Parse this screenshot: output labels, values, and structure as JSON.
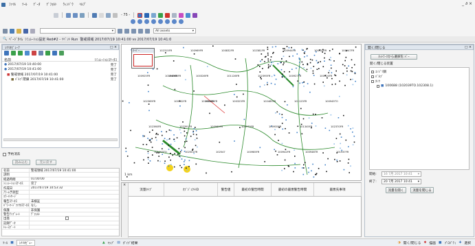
{
  "menus": [
    "ﾌｧｲﾙ",
    "ﾂｰﾙ",
    "ﾃﾞｰﾀ",
    "ﾃﾞﾌｫﾙﾄ",
    "ｳｨﾝﾄﾞｳ",
    "ﾍﾙﾌﾟ"
  ],
  "window_controls": "_ ∂ ×",
  "toolbar2": {
    "zoom_label": "- 75 -"
  },
  "toolbar3": {
    "layer_combo": "All assets"
  },
  "status": {
    "label": "ﾍﾟｰｼﾞﾀｲﾑ",
    "source": "ｼﾐｭﾚｰｼｮﾝ設定 Red#2 - ｲﾍﾞﾝﾄ Run",
    "compare": "警戒領域 2017/07/19 10:41:00 vs 2017/07/19 10:41:0"
  },
  "left_panel": {
    "title": "ｼﾅﾘｵﾋﾞｭｰｱ",
    "col_name": "名前",
    "col_status": "ｼﾐｭﾚｰｼｮﾝｽﾃｰﾀｽ",
    "tree": [
      {
        "label": "2017/07/19 10:40:00",
        "status": "完了"
      },
      {
        "label": "2017/07/19 10:41:00",
        "status": "完了"
      },
      {
        "label": "警戒領域 2017/07/19 10:41:00",
        "status": "完了"
      },
      {
        "label": "ﾊﾞﾙﾌﾞ閉鎖 2017/07/19 10:41:00",
        "status": "完了"
      }
    ],
    "checkbox_label": "予約消去",
    "btn_read": "読み込む",
    "btn_update": "元に戻す"
  },
  "props": [
    {
      "k": "名前",
      "v": "警戒領域 2017/07/19 10:41:00"
    },
    {
      "k": "説明",
      "v": ""
    },
    {
      "k": "経過時間",
      "v": "01:00:00"
    },
    {
      "k": "ｼﾐｭﾚｰｼｮﾝｽﾃｰﾀｽ",
      "v": "完了"
    },
    {
      "k": "作成日",
      "v": "2017/07/19 10:53:32"
    },
    {
      "k": "ｱﾗｰﾑ予測型",
      "v": ""
    },
    {
      "k": "ｴﾗｰﾒｯｾｰｼﾞ",
      "v": ""
    },
    {
      "k": "報告ｽﾃｰﾀｽ",
      "v": "未検証"
    },
    {
      "k": "ﾊﾟﾜｰﾏｰｼﾞﾌｧｸﾀｽﾃｰﾀｽ",
      "v": "なし"
    },
    {
      "k": "保護",
      "v": "非保護"
    },
    {
      "k": "警告ﾃﾝﾌﾟﾚｰﾄ",
      "v": "ﾃﾞﾌｫﾙﾄ"
    },
    {
      "k": "出発",
      "v": ""
    },
    {
      "k": "記録ﾃﾞｰﾀ",
      "v": ""
    },
    {
      "k": "ﾄﾚｰｽﾌﾞｰﾄ",
      "v": ""
    }
  ],
  "map": {
    "overview_label": "ｵｰﾊﾞｰ",
    "scale": "1 km"
  },
  "table": {
    "headers": [
      "流量ﾀｲﾌﾟ",
      "ｵﾌﾞｼﾞｪｸﾄID",
      "警告値",
      "最初の警告時間",
      "最初の最悪警告時間",
      "最悪先事項"
    ]
  },
  "right_panel": {
    "title": "開く/閉じる",
    "network_btn": "ﾈｯﾄﾜｰｸから選択を:ﾍﾞｰ",
    "list_title": "開く/閉じる装置",
    "items": [
      "ｺﾝｼﾞﾂ鋼",
      "ﾊﾞﾙﾌﾞ",
      "ﾀﾝｸ",
      "100688 (102039TO.102308.1)"
    ],
    "start_label": "開始:",
    "start_value": "16 7月 2017 10:41",
    "end_label": "終了:",
    "end_value": "20 7月 2017 10:41",
    "btn_open": "流量を開く",
    "btn_close": "流量を閉じる"
  },
  "bottom": {
    "tab1": "ﾂｰﾙ",
    "tab2": "ｼﾅﾘｵﾋﾞｭｰ",
    "tab3": "ﾏｯﾌﾟ",
    "tab4": "ﾎﾟｲﾌﾟ結果",
    "r1": "開く/閉じる",
    "r2": "描画",
    "r3": "ﾌﾟﾛﾊﾟﾃｨ",
    "r4": "選択"
  },
  "map_labels": [
    "100949FR",
    "100945FR",
    "100949FR",
    "100973FR",
    "100942FR",
    "100925FR",
    "100925FR",
    "100942FR",
    "100960FR",
    "100985FR",
    "100944FR",
    "100924FR",
    "102369FR",
    "102391FR",
    "102547",
    "102381FR",
    "100927FR",
    "100945TO",
    "102398FR",
    "102501FR",
    "100832FR",
    "102395FR",
    "101123FR",
    "102370FR",
    "101193TO",
    "100969FR",
    "101126FR",
    "102485FR",
    "101345FR",
    "101937FR",
    "102315FR",
    "100326FR",
    "100323FR",
    "100935FR",
    "100946TR",
    "100947FR",
    "101940FR",
    "101924FR"
  ]
}
